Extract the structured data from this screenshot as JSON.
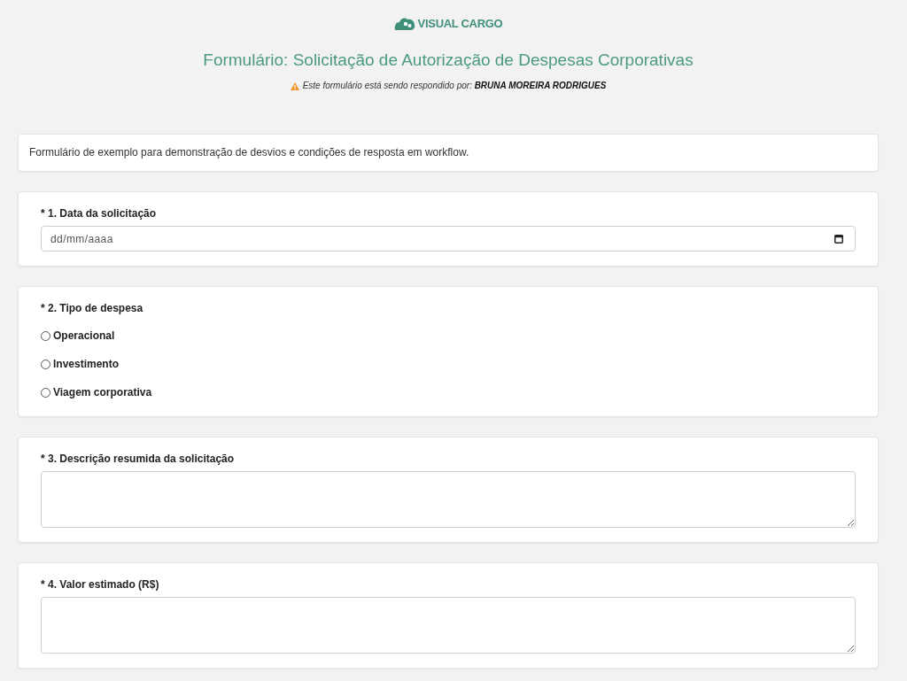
{
  "header": {
    "logo": {
      "text": "VISUAL CARGO"
    },
    "title": "Formulário: Solicitação de Autorização de Despesas Corporativas",
    "notice": "Este formulário está sendo respondido por: **BRUNA MOREIRA RODRIGUES**"
  },
  "intro": "Formulário de exemplo para demonstração de desvios e condições de resposta em workflow.",
  "questions": [
    {
      "kind": "date",
      "label": "* 1. Data da solicitação",
      "placeholder": "dd/mm/aaaa"
    },
    {
      "kind": "radio",
      "label": "* 2. Tipo de despesa",
      "options": [
        {
          "label": "Operacional",
          "selected": false
        },
        {
          "label": "Investimento",
          "selected": false
        },
        {
          "label": "Viagem corporativa",
          "selected": false
        }
      ]
    },
    {
      "kind": "textarea",
      "label": "* 3. Descrição resumida da solicitação"
    },
    {
      "kind": "textarea",
      "label": "* 4. Valor estimado (R$)"
    }
  ]
}
